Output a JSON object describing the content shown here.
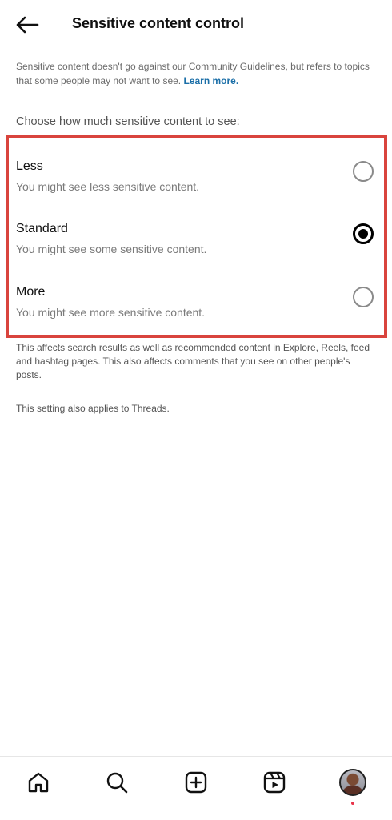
{
  "header": {
    "title": "Sensitive content control",
    "back_icon": "arrow-left-icon"
  },
  "intro": {
    "text": "Sensitive content doesn't go against our Community Guidelines, but refers to topics that some people may not want to see. ",
    "link_label": "Learn more."
  },
  "choose_label": "Choose how much sensitive content to see:",
  "options": [
    {
      "title": "Less",
      "subtitle": "You might see less sensitive content.",
      "selected": false
    },
    {
      "title": "Standard",
      "subtitle": "You might see some sensitive content.",
      "selected": true
    },
    {
      "title": "More",
      "subtitle": "You might see more sensitive content.",
      "selected": false
    }
  ],
  "footnote": "This affects search results as well as recommended content in Explore, Reels, feed and hashtag pages. This also affects comments that you see on other people's posts.",
  "threads_note": "This setting also applies to Threads.",
  "bottom_nav": {
    "items": [
      {
        "icon": "home-icon"
      },
      {
        "icon": "search-icon"
      },
      {
        "icon": "create-post-icon"
      },
      {
        "icon": "reels-icon"
      },
      {
        "icon": "profile-avatar"
      }
    ]
  },
  "colors": {
    "highlight_border": "#d9443d",
    "link": "#1b6fa8",
    "notification_dot": "#e8334a"
  }
}
